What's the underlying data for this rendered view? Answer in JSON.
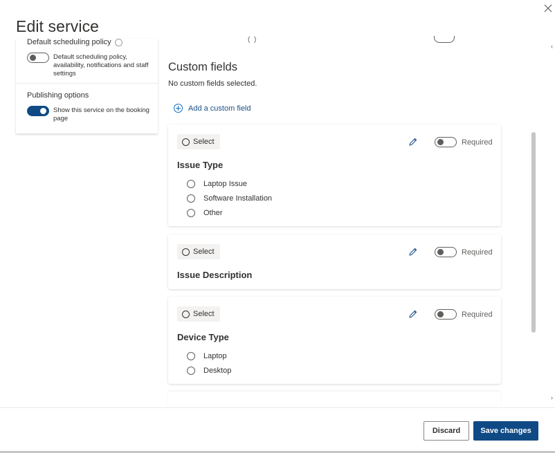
{
  "dialog": {
    "title": "Edit service",
    "close_icon": "close-icon"
  },
  "left_panel": {
    "scheduling": {
      "heading": "Default scheduling policy",
      "toggle_on": false,
      "description": "Default scheduling policy, availability, notifications and staff settings"
    },
    "publishing": {
      "heading": "Publishing options",
      "toggle_on": true,
      "description": "Show this service on the booking page"
    }
  },
  "custom_fields": {
    "title": "Custom fields",
    "empty_text": "No custom fields selected.",
    "add_label": "Add a custom field",
    "select_label": "Select",
    "required_label": "Required",
    "cards": [
      {
        "title": "Issue Type",
        "required": false,
        "options": [
          "Laptop Issue",
          "Software Installation",
          "Other"
        ]
      },
      {
        "title": "Issue Description",
        "required": false,
        "options": []
      },
      {
        "title": "Device Type",
        "required": false,
        "options": [
          "Laptop",
          "Desktop"
        ]
      }
    ]
  },
  "footer": {
    "discard_label": "Discard",
    "save_label": "Save changes"
  },
  "colors": {
    "accent": "#0f4a85",
    "link": "#1b4f86"
  }
}
